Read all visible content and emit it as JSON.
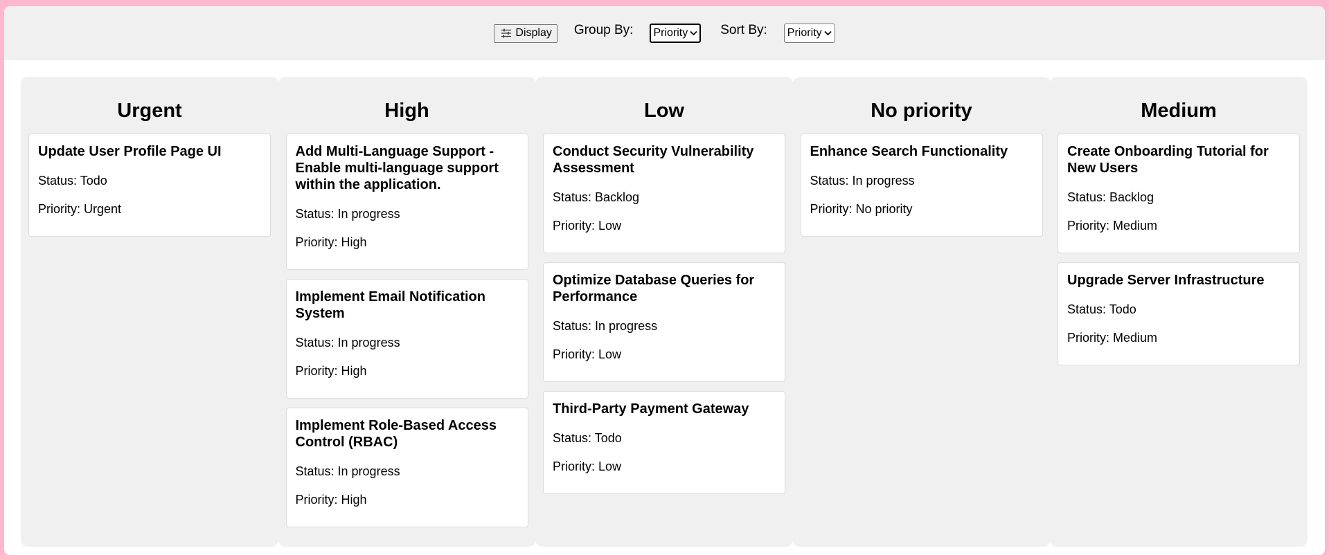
{
  "toolbar": {
    "display_label": "Display",
    "group_by_label": "Group By:",
    "group_by_value": "Priority",
    "sort_by_label": "Sort By:",
    "sort_by_value": "Priority"
  },
  "labels": {
    "status_prefix": "Status: ",
    "priority_prefix": "Priority: "
  },
  "columns": [
    {
      "title": "Urgent",
      "cards": [
        {
          "title": "Update User Profile Page UI",
          "status": "Todo",
          "priority": "Urgent"
        }
      ]
    },
    {
      "title": "High",
      "cards": [
        {
          "title": "Add Multi-Language Support - Enable multi-language support within the application.",
          "status": "In progress",
          "priority": "High"
        },
        {
          "title": "Implement Email Notification System",
          "status": "In progress",
          "priority": "High"
        },
        {
          "title": "Implement Role-Based Access Control (RBAC)",
          "status": "In progress",
          "priority": "High"
        }
      ]
    },
    {
      "title": "Low",
      "cards": [
        {
          "title": "Conduct Security Vulnerability Assessment",
          "status": "Backlog",
          "priority": "Low"
        },
        {
          "title": "Optimize Database Queries for Performance",
          "status": "In progress",
          "priority": "Low"
        },
        {
          "title": "Third-Party Payment Gateway",
          "status": "Todo",
          "priority": "Low"
        }
      ]
    },
    {
      "title": "No priority",
      "cards": [
        {
          "title": "Enhance Search Functionality",
          "status": "In progress",
          "priority": "No priority"
        }
      ]
    },
    {
      "title": "Medium",
      "cards": [
        {
          "title": "Create Onboarding Tutorial for New Users",
          "status": "Backlog",
          "priority": "Medium"
        },
        {
          "title": "Upgrade Server Infrastructure",
          "status": "Todo",
          "priority": "Medium"
        }
      ]
    }
  ]
}
